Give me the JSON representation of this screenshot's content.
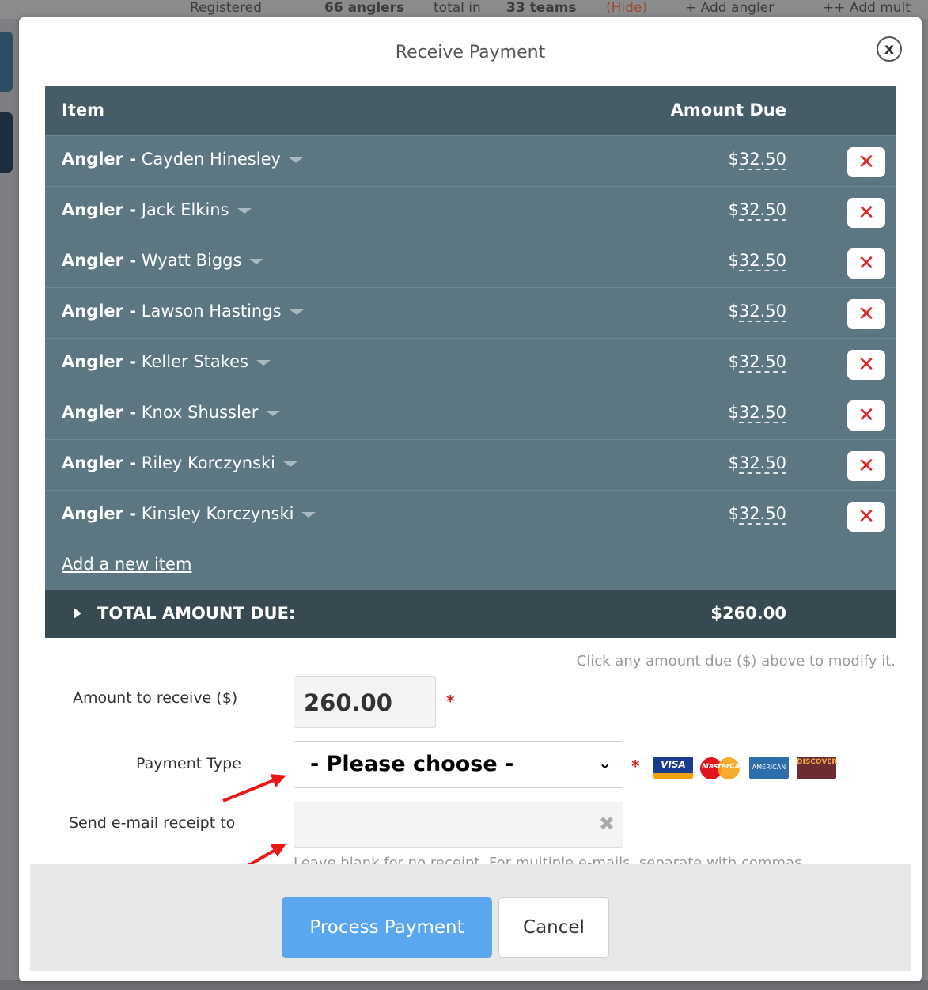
{
  "background": {
    "registered_label": "Registered",
    "anglers_total": "66 anglers",
    "total_in": "total in",
    "teams": "33 teams",
    "hide_link": "(Hide)",
    "add_angler": "+ Add angler",
    "add_multi": "++ Add mult"
  },
  "modal": {
    "title": "Receive Payment",
    "close_glyph": "x"
  },
  "table": {
    "col_item": "Item",
    "col_amount": "Amount Due",
    "rows": [
      {
        "type": "Angler -",
        "name": "Cayden Hinesley",
        "currency": "$",
        "amount": "32.50",
        "delete": "✕"
      },
      {
        "type": "Angler -",
        "name": "Jack Elkins",
        "currency": "$",
        "amount": "32.50",
        "delete": "✕"
      },
      {
        "type": "Angler -",
        "name": "Wyatt Biggs",
        "currency": "$",
        "amount": "32.50",
        "delete": "✕"
      },
      {
        "type": "Angler -",
        "name": "Lawson Hastings",
        "currency": "$",
        "amount": "32.50",
        "delete": "✕"
      },
      {
        "type": "Angler -",
        "name": "Keller Stakes",
        "currency": "$",
        "amount": "32.50",
        "delete": "✕"
      },
      {
        "type": "Angler -",
        "name": "Knox Shussler",
        "currency": "$",
        "amount": "32.50",
        "delete": "✕"
      },
      {
        "type": "Angler -",
        "name": "Riley Korczynski",
        "currency": "$",
        "amount": "32.50",
        "delete": "✕"
      },
      {
        "type": "Angler -",
        "name": "Kinsley Korczynski",
        "currency": "$",
        "amount": "32.50",
        "delete": "✕"
      }
    ],
    "add_item": "Add a new item",
    "total_label": "TOTAL AMOUNT DUE:",
    "total_value": "$260.00"
  },
  "hint": "Click any amount due ($) above to modify it.",
  "form": {
    "amount_label": "Amount to receive ($)",
    "amount_value": "260.00",
    "payment_type_label": "Payment Type",
    "payment_type_value": "- Please choose -",
    "email_label": "Send e-mail receipt to",
    "email_value": "",
    "email_help": "Leave blank for no receipt. For multiple e-mails, separate with commas.",
    "required_mark": "*",
    "clear_glyph": "✖"
  },
  "cards": {
    "visa": "VISA",
    "mastercard": "MasterCard",
    "amex": "AMERICAN EXPRESS",
    "discover": "DISCOVER"
  },
  "colors": {
    "table_header": "#465c66",
    "table_row": "#5c7782",
    "total_row": "#374a52",
    "process_button": "#5aa7ef",
    "delete_x": "#e02424",
    "annotation_arrow": "#e81818"
  },
  "buttons": {
    "process": "Process Payment",
    "cancel": "Cancel"
  }
}
